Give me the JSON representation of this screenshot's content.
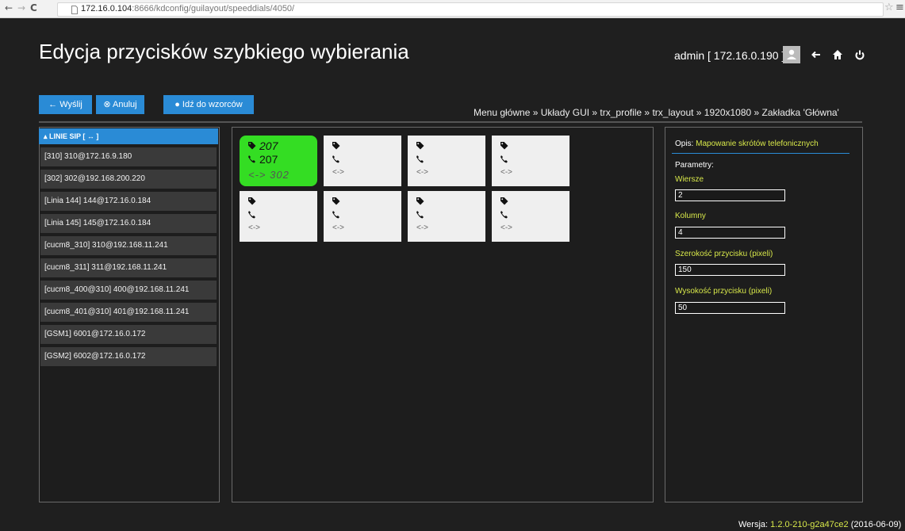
{
  "browser": {
    "url_host": "172.16.0.104",
    "url_path": ":8666/kdconfig/guilayout/speeddials/4050/"
  },
  "header": {
    "title": "Edycja przycisków szybkiego wybierania",
    "user": "admin [ 172.16.0.190 ]"
  },
  "toolbar": {
    "send": "← Wyślij",
    "cancel": "⊗ Anuluj",
    "templates": "● Idź do wzorców"
  },
  "breadcrumb": "Menu główne » Układy GUI » trx_profile » trx_layout » 1920x1080 » Zakładka 'Główna'",
  "sip_panel": {
    "header": "▴ LINIE SIP [ ↔ ]",
    "items": [
      "[310] 310@172.16.9.180",
      "[302] 302@192.168.200.220",
      "[Linia 144] 144@172.16.0.184",
      "[Linia 145] 145@172.16.0.184",
      "[cucm8_310] 310@192.168.11.241",
      "[cucm8_311] 311@192.168.11.241",
      "[cucm8_400@310] 400@192.168.11.241",
      "[cucm8_401@310] 401@192.168.11.241",
      "[GSM1] 6001@172.16.0.172",
      "[GSM2] 6002@172.16.0.172"
    ]
  },
  "speeddials": {
    "buttons": [
      {
        "label": "207",
        "number": "207",
        "line": "302",
        "active": true
      },
      {
        "label": "",
        "number": "",
        "line": "",
        "active": false
      },
      {
        "label": "",
        "number": "",
        "line": "",
        "active": false
      },
      {
        "label": "",
        "number": "",
        "line": "",
        "active": false
      },
      {
        "label": "",
        "number": "",
        "line": "",
        "active": false
      },
      {
        "label": "",
        "number": "",
        "line": "",
        "active": false
      },
      {
        "label": "",
        "number": "",
        "line": "",
        "active": false
      },
      {
        "label": "",
        "number": "",
        "line": "",
        "active": false
      }
    ],
    "line_icon": "<->"
  },
  "properties": {
    "opis_label": "Opis:",
    "opis_value": "Mapowanie skrótów telefonicznych",
    "params_label": "Parametry:",
    "fields": [
      {
        "label": "Wiersze",
        "value": "2"
      },
      {
        "label": "Kolumny",
        "value": "4"
      },
      {
        "label": "Szerokość przycisku (pixeli)",
        "value": "150"
      },
      {
        "label": "Wysokość przycisku (pixeli)",
        "value": "50"
      }
    ]
  },
  "footer": {
    "label": "Wersja:",
    "version": "1.2.0-210-g2a47ce2",
    "date": "(2016-06-09)"
  },
  "colors": {
    "accent": "#2a8bd6",
    "highlight": "#d8e84a",
    "active_button": "#34dd23"
  },
  "icons": [
    "arrow-left-icon",
    "arrow-right-icon",
    "reload-icon",
    "page-icon",
    "star-icon",
    "menu-icon",
    "user-icon",
    "back-icon",
    "home-icon",
    "power-icon",
    "tag-icon",
    "phone-icon"
  ]
}
